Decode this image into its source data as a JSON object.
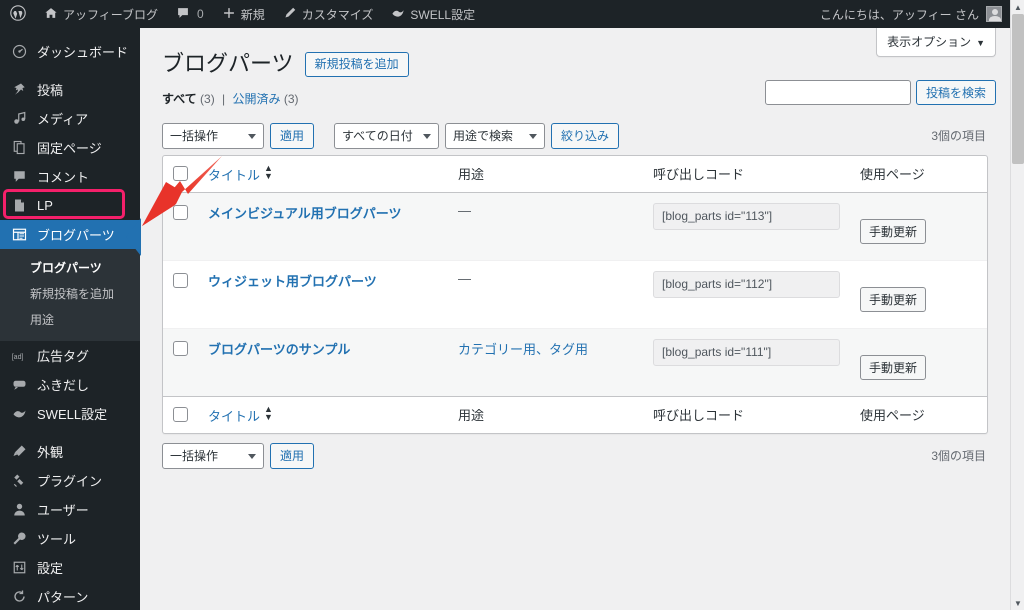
{
  "adminbar": {
    "logo_icon": "wordpress-logo-icon",
    "site": {
      "icon": "home-icon",
      "label": "アッフィーブログ"
    },
    "comments": {
      "icon": "comment-icon",
      "count": "0"
    },
    "new": {
      "icon": "plus-icon",
      "label": "新規"
    },
    "customize": {
      "icon": "pencil-icon",
      "label": "カスタマイズ"
    },
    "swell": {
      "icon": "swell-icon",
      "label": "SWELL設定"
    },
    "howdy": "こんにちは、アッフィー さん",
    "avatar_icon": "avatar-icon"
  },
  "sidebar": {
    "items": [
      {
        "icon": "dashboard-icon",
        "label": "ダッシュボード",
        "current": false,
        "gap_after": true
      },
      {
        "icon": "post-icon",
        "label": "投稿",
        "current": false,
        "gap_after": false
      },
      {
        "icon": "media-icon",
        "label": "メディア",
        "current": false,
        "gap_after": false
      },
      {
        "icon": "page-icon",
        "label": "固定ページ",
        "current": false,
        "gap_after": false
      },
      {
        "icon": "comment-icon",
        "label": "コメント",
        "current": false,
        "gap_after": false
      },
      {
        "icon": "lp-icon",
        "label": "LP",
        "current": false,
        "gap_after": false
      },
      {
        "icon": "blogparts-icon",
        "label": "ブログパーツ",
        "current": true,
        "gap_after": false
      }
    ],
    "submenu": [
      {
        "label": "ブログパーツ",
        "active": true
      },
      {
        "label": "新規投稿を追加",
        "active": false
      },
      {
        "label": "用途",
        "active": false
      }
    ],
    "items2": [
      {
        "icon": "ad-tag-icon",
        "label": "広告タグ",
        "gap_after": false
      },
      {
        "icon": "balloon-icon",
        "label": "ふきだし",
        "gap_after": false
      },
      {
        "icon": "swell-icon",
        "label": "SWELL設定",
        "gap_after": true
      },
      {
        "icon": "appearance-icon",
        "label": "外観",
        "gap_after": false
      },
      {
        "icon": "plugins-icon",
        "label": "プラグイン",
        "gap_after": false
      },
      {
        "icon": "users-icon",
        "label": "ユーザー",
        "gap_after": false
      },
      {
        "icon": "tools-icon",
        "label": "ツール",
        "gap_after": false
      },
      {
        "icon": "settings-icon",
        "label": "設定",
        "gap_after": false
      },
      {
        "icon": "patterns-icon",
        "label": "パターン",
        "gap_after": false
      }
    ]
  },
  "screen_options": {
    "label": "表示オプション",
    "caret": "▼"
  },
  "header": {
    "title": "ブログパーツ",
    "add_new": "新規投稿を追加"
  },
  "views": {
    "all_label": "すべて",
    "all_count": "(3)",
    "divider": "|",
    "published_label": "公開済み",
    "published_count": "(3)"
  },
  "search": {
    "value": "",
    "placeholder": "",
    "button": "投稿を検索"
  },
  "tablenav_top": {
    "bulk_action": "一括操作",
    "apply": "適用",
    "date_filter": "すべての日付",
    "use_filter": "用途で検索",
    "filter_button": "絞り込み",
    "displaying": "3個の項目"
  },
  "tablenav_bottom": {
    "bulk_action": "一括操作",
    "apply": "適用",
    "displaying": "3個の項目"
  },
  "table": {
    "columns": {
      "title": "タイトル",
      "use": "用途",
      "code": "呼び出しコード",
      "pages": "使用ページ"
    },
    "rows": [
      {
        "title": "メインビジュアル用ブログパーツ",
        "use": "—",
        "use_is_link": false,
        "code": "[blog_parts id=\"113\"]",
        "refresh": "手動更新"
      },
      {
        "title": "ウィジェット用ブログパーツ",
        "use": "—",
        "use_is_link": false,
        "code": "[blog_parts id=\"112\"]",
        "refresh": "手動更新"
      },
      {
        "title": "ブログパーツのサンプル",
        "use": "カテゴリー用、タグ用",
        "use_is_link": true,
        "code": "[blog_parts id=\"111\"]",
        "refresh": "手動更新"
      }
    ]
  },
  "annotations": {
    "arrow_color": "#e8332a",
    "highlight_color": "#f4206a",
    "collapse_tab_color": "#2271b1"
  },
  "colors": {
    "admin_bar": "#1d2327",
    "sidebar": "#1d2327",
    "submenu": "#2c3338",
    "current_menu": "#2271b1",
    "link": "#2271b1",
    "page_bg": "#f0f0f1"
  }
}
